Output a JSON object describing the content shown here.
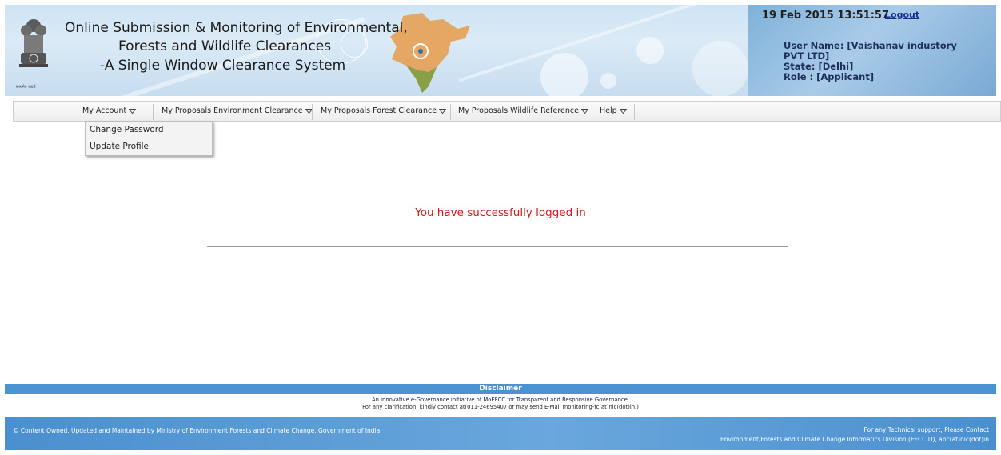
{
  "header": {
    "title_lines": [
      "Online Submission & Monitoring of Environmental,",
      "Forests and Wildlife Clearances",
      "-A Single Window Clearance System"
    ],
    "datetime": "19 Feb 2015 13:51:57",
    "logout_label": "Logout",
    "user_lines": [
      "User Name: [Vaishanav industory",
      "PVT LTD]",
      "State: [Delhi]",
      "Role : [Applicant]"
    ],
    "emblem_text": "सत्यमेव जयते"
  },
  "menu": {
    "items": [
      {
        "label": "My Account"
      },
      {
        "label": "My Proposals Environment Clearance"
      },
      {
        "label": "My Proposals Forest Clearance"
      },
      {
        "label": "My Proposals Wildlife Reference"
      },
      {
        "label": "Help"
      }
    ],
    "dropdown": [
      {
        "label": "Change Password"
      },
      {
        "label": "Update Profile"
      }
    ]
  },
  "main": {
    "message": "You have successfully logged in"
  },
  "disclaimer": {
    "title": "Disclaimer",
    "lines": [
      "An innovative e-Governance initiative of MoEFCC for Transparent and Responsive Governance.",
      "For any clarification, kindly contact at(011-24695407 or may send E-Mail monitoring-fc(at)nic(dot)in.)"
    ]
  },
  "footer": {
    "left": "© Content Owned, Updated and Maintained by Ministry of Environment,Forests and Climate Change, Government of India",
    "right_lines": [
      "For any Technical support, Please Contact",
      "Environment,Forests and Climate Change Informatics Division (EFCCID), abc(at)nic(dot)in"
    ]
  },
  "colors": {
    "success_text": "#d11a1a",
    "bar_blue": "#4a93d3",
    "logout_link": "#1b2f8f"
  }
}
